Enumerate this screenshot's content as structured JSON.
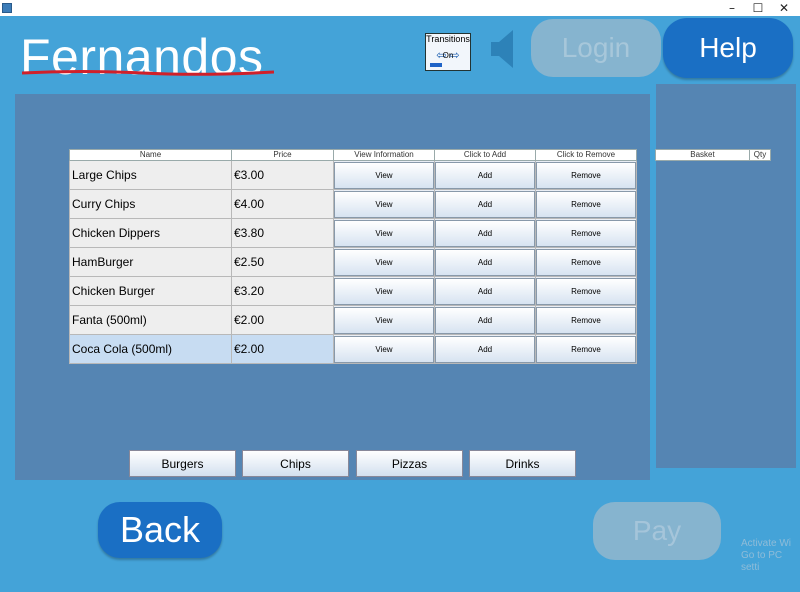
{
  "window": {
    "minimize_glyph": "–",
    "maximize_glyph": "☐",
    "close_glyph": "✕"
  },
  "brand": {
    "name": "Fernandos",
    "spellcheck_underline_color": "#d0202a"
  },
  "toolbar": {
    "transitions_label": "Transitions",
    "transitions_state": "On",
    "transitions_arrows": "⇦  ⇨",
    "sound_icon": "speaker-icon",
    "login_label": "Login",
    "help_label": "Help"
  },
  "menu": {
    "headers": [
      "Name",
      "Price",
      "View Information",
      "Click to Add",
      "Click to Remove"
    ],
    "view_label": "View",
    "add_label": "Add",
    "remove_label": "Remove",
    "items": [
      {
        "name": "Large Chips",
        "price": "€3.00"
      },
      {
        "name": "Curry Chips",
        "price": "€4.00"
      },
      {
        "name": "Chicken Dippers",
        "price": "€3.80"
      },
      {
        "name": "HamBurger",
        "price": "€2.50"
      },
      {
        "name": "Chicken Burger",
        "price": "€3.20"
      },
      {
        "name": "Fanta (500ml)",
        "price": "€2.00"
      },
      {
        "name": "Coca Cola (500ml)",
        "price": "€2.00"
      }
    ],
    "selected_item": "Coca Cola (500ml)"
  },
  "basket": {
    "headers": [
      "Basket",
      "Qty"
    ]
  },
  "categories": [
    "Burgers",
    "Chips",
    "Pizzas",
    "Drinks"
  ],
  "footer": {
    "back_label": "Back",
    "pay_label": "Pay"
  },
  "watermark": {
    "line1": "Activate Wi",
    "line2": "Go to PC setti"
  },
  "colors": {
    "background": "#44a3d8",
    "panel": "#5585b3",
    "primary_button": "#1a6fc4",
    "disabled_button": "#86b4cf"
  }
}
